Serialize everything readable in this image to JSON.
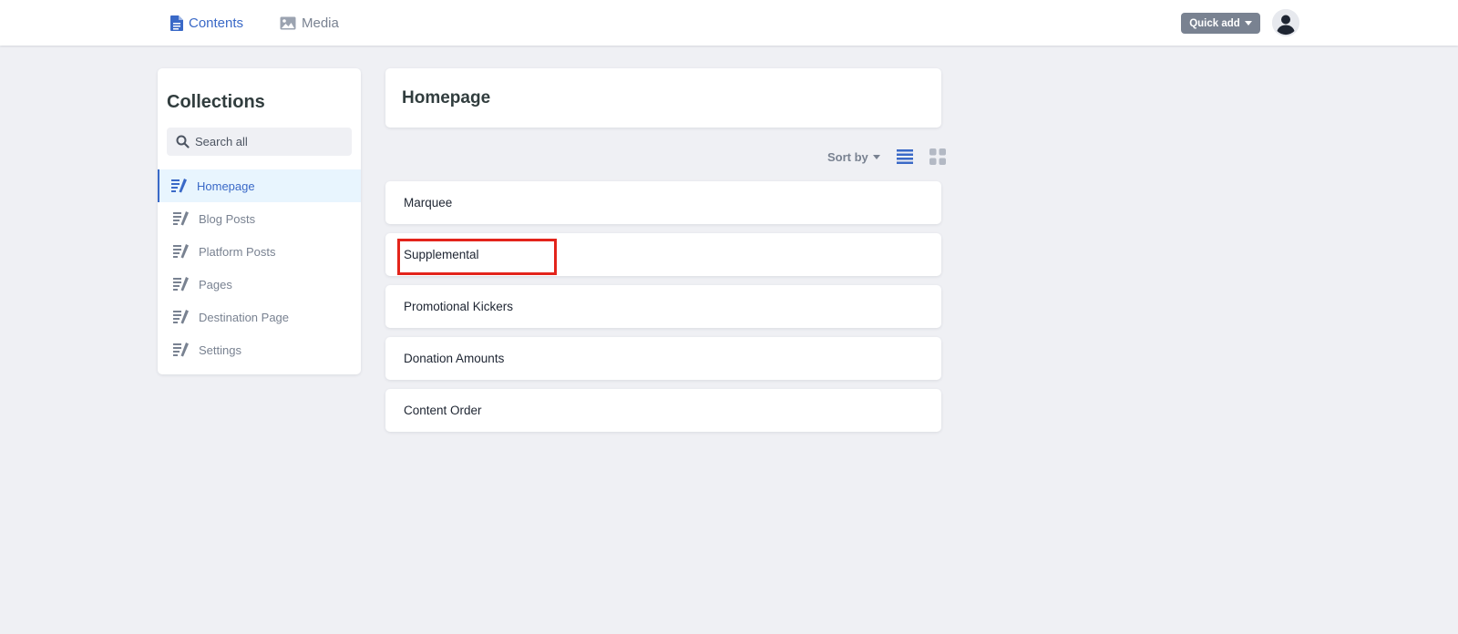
{
  "topbar": {
    "nav": [
      {
        "label": "Contents",
        "icon": "document-icon",
        "active": true
      },
      {
        "label": "Media",
        "icon": "image-icon",
        "active": false
      }
    ],
    "quick_add_label": "Quick add",
    "colors": {
      "active": "#3a69c7",
      "inactive": "#798291"
    }
  },
  "sidebar": {
    "title": "Collections",
    "search_placeholder": "Search all",
    "items": [
      {
        "label": "Homepage",
        "active": true
      },
      {
        "label": "Blog Posts",
        "active": false
      },
      {
        "label": "Platform Posts",
        "active": false
      },
      {
        "label": "Pages",
        "active": false
      },
      {
        "label": "Destination Page",
        "active": false
      },
      {
        "label": "Settings",
        "active": false
      }
    ]
  },
  "main": {
    "title": "Homepage",
    "sort_label": "Sort by",
    "view_modes": [
      "list-view-icon",
      "grid-view-icon"
    ],
    "entries": [
      {
        "label": "Marquee"
      },
      {
        "label": "Supplemental"
      },
      {
        "label": "Promotional Kickers"
      },
      {
        "label": "Donation Amounts"
      },
      {
        "label": "Content Order"
      }
    ]
  },
  "highlight_color": "#e3241b"
}
